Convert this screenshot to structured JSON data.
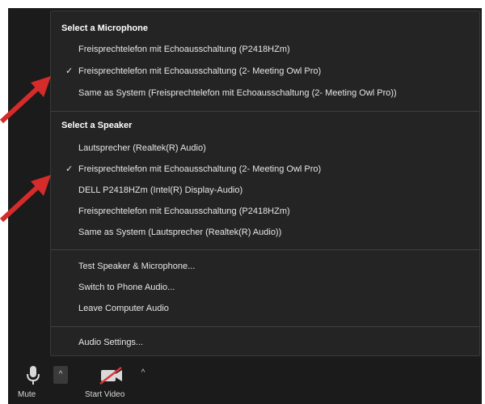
{
  "microphone": {
    "title": "Select a Microphone",
    "items": [
      {
        "label": "Freisprechtelefon mit Echoausschaltung (P2418HZm)",
        "checked": false
      },
      {
        "label": "Freisprechtelefon mit Echoausschaltung (2- Meeting Owl Pro)",
        "checked": true
      },
      {
        "label": "Same as System  (Freisprechtelefon mit Echoausschaltung (2- Meeting Owl Pro))",
        "checked": false
      }
    ]
  },
  "speaker": {
    "title": "Select a Speaker",
    "items": [
      {
        "label": "Lautsprecher (Realtek(R) Audio)",
        "checked": false
      },
      {
        "label": "Freisprechtelefon mit Echoausschaltung (2- Meeting Owl Pro)",
        "checked": true
      },
      {
        "label": "DELL P2418HZm (Intel(R) Display-Audio)",
        "checked": false
      },
      {
        "label": "Freisprechtelefon mit Echoausschaltung (P2418HZm)",
        "checked": false
      },
      {
        "label": "Same as System  (Lautsprecher (Realtek(R) Audio))",
        "checked": false
      }
    ]
  },
  "actions": [
    {
      "label": "Test Speaker & Microphone..."
    },
    {
      "label": "Switch to Phone Audio..."
    },
    {
      "label": "Leave Computer Audio"
    }
  ],
  "settings": {
    "label": "Audio Settings..."
  },
  "check_glyph": "✓",
  "toolbar": {
    "mute_label": "Mute",
    "start_video_label": "Start Video",
    "caret_glyph": "^"
  },
  "colors": {
    "menu_bg": "#242424",
    "toolbar_bg": "#1b1b1b",
    "arrow": "#d62b2b",
    "video_slash": "#e0333a"
  }
}
